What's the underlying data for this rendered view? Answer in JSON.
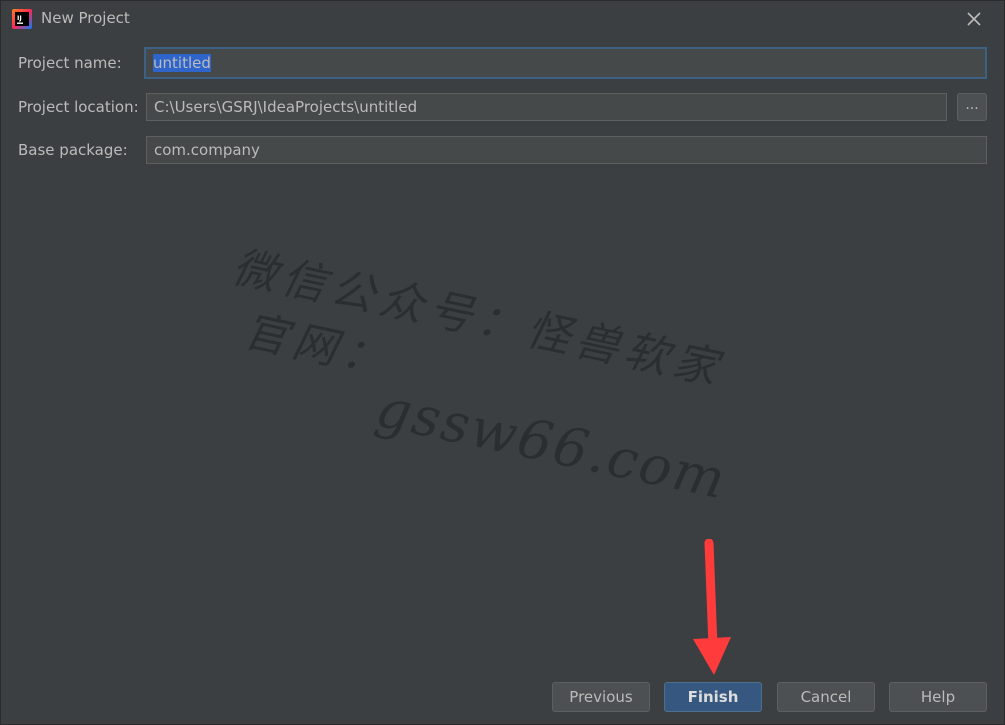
{
  "window": {
    "title": "New Project",
    "app_icon": "intellij-idea-icon",
    "close_icon": "close-icon"
  },
  "form": {
    "project_name": {
      "label": "Project name:",
      "value": "untitled"
    },
    "project_location": {
      "label": "Project location:",
      "value": "C:\\Users\\GSRJ\\IdeaProjects\\untitled",
      "browse_label": "..."
    },
    "base_package": {
      "label": "Base package:",
      "value": "com.company"
    }
  },
  "watermark": {
    "line1": "微信公众号：怪兽软家",
    "line2": "官网：",
    "line3": "gssw66.com"
  },
  "buttons": {
    "previous": "Previous",
    "finish": "Finish",
    "cancel": "Cancel",
    "help": "Help"
  },
  "colors": {
    "background": "#3c3f41",
    "field_bg": "#45494a",
    "focus_border": "#3d6185",
    "selection": "#2f65ca",
    "primary_button": "#365880",
    "annotation_arrow": "#ff3b3b"
  }
}
